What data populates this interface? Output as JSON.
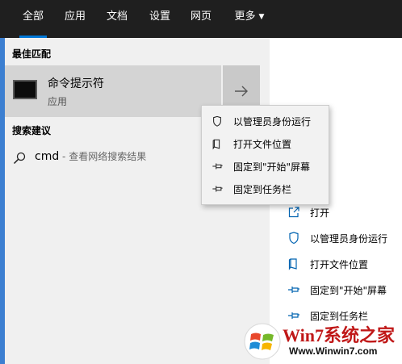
{
  "tabs": [
    {
      "label": "全部",
      "active": true
    },
    {
      "label": "应用"
    },
    {
      "label": "文档"
    },
    {
      "label": "设置"
    },
    {
      "label": "网页"
    },
    {
      "label": "更多"
    }
  ],
  "best_match": {
    "heading": "最佳匹配",
    "app_name": "命令提示符",
    "app_type": "应用",
    "icon": "cmd-terminal-icon"
  },
  "suggestions": {
    "heading": "搜索建议",
    "query": "cmd",
    "suffix": " - 查看网络搜索结果"
  },
  "context_menu": [
    {
      "label": "以管理员身份运行",
      "icon": "shield-icon"
    },
    {
      "label": "打开文件位置",
      "icon": "folder-icon"
    },
    {
      "label": "固定到\"开始\"屏幕",
      "icon": "pin-icon"
    },
    {
      "label": "固定到任务栏",
      "icon": "pin-icon"
    }
  ],
  "right_actions": [
    {
      "label": "打开",
      "icon": "open-icon"
    },
    {
      "label": "以管理员身份运行",
      "icon": "shield-icon"
    },
    {
      "label": "打开文件位置",
      "icon": "folder-icon"
    },
    {
      "label": "固定到\"开始\"屏幕",
      "icon": "pin-icon"
    },
    {
      "label": "固定到任务栏",
      "icon": "pin-icon"
    }
  ],
  "watermark": {
    "title": "Win7系统之家",
    "url": "Www.Winwin7.com"
  },
  "colors": {
    "accent": "#0078d7",
    "topbar": "#1f1f1f",
    "panel": "#f0f0f0",
    "selected": "#d4d4d4"
  }
}
